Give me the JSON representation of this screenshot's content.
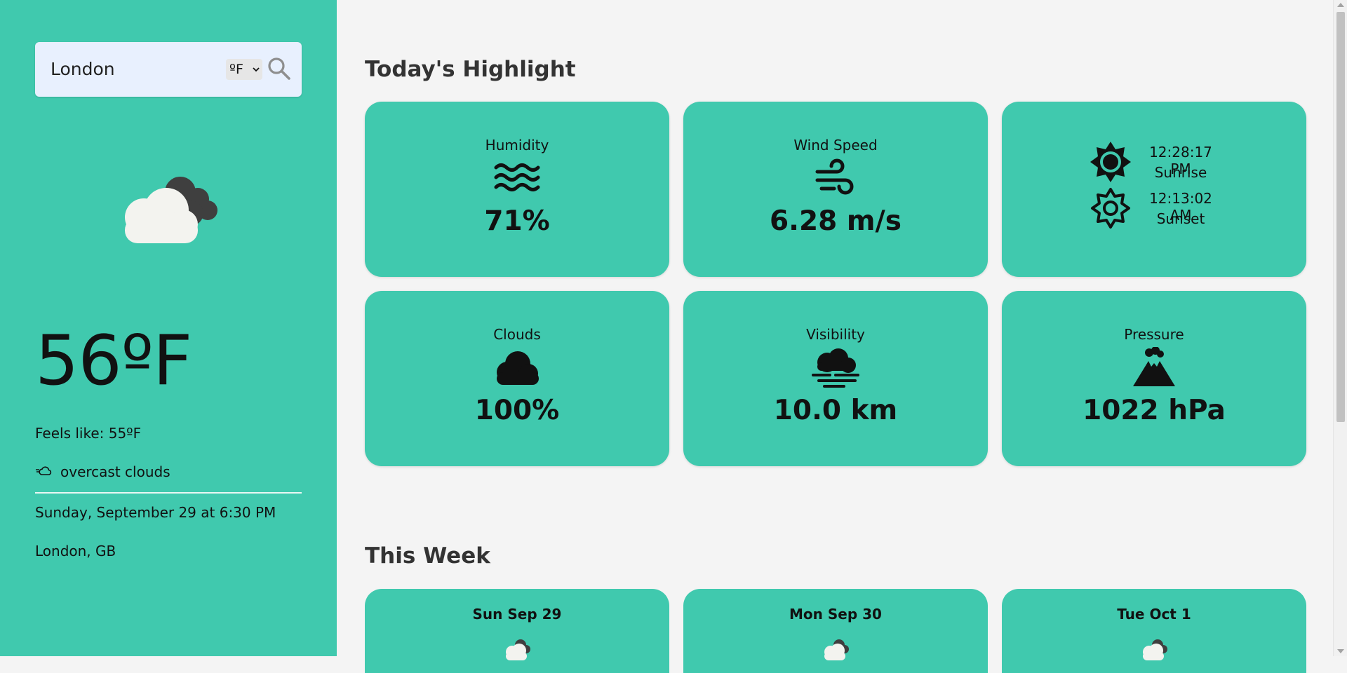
{
  "search": {
    "value": "London",
    "unit": "ºF"
  },
  "current": {
    "temp": "56ºF",
    "feels_like": "Feels like: 55ºF",
    "condition": "overcast clouds",
    "date": "Sunday, September 29 at 6:30 PM",
    "location": "London, GB"
  },
  "highlights": {
    "title": "Today's Highlight",
    "humidity": {
      "label": "Humidity",
      "value": "71%"
    },
    "wind": {
      "label": "Wind Speed",
      "value": "6.28 m/s"
    },
    "sunrise": {
      "time": "12:28:17 PM",
      "label": "Sunrise"
    },
    "sunset": {
      "time": "12:13:02 AM",
      "label": "Sunset"
    },
    "clouds": {
      "label": "Clouds",
      "value": "100%"
    },
    "visibility": {
      "label": "Visibility",
      "value": "10.0 km"
    },
    "pressure": {
      "label": "Pressure",
      "value": "1022 hPa"
    }
  },
  "week": {
    "title": "This Week",
    "days": [
      {
        "label": "Sun Sep 29",
        "icon": "cloud-icon"
      },
      {
        "label": "Mon Sep 30",
        "icon": "cloud-icon"
      },
      {
        "label": "Tue Oct 1",
        "icon": "cloud-icon"
      }
    ]
  },
  "colors": {
    "sidebar": "#40c9ae",
    "card": "#40c9ae",
    "background": "#f4f4f4",
    "search_bg": "#e8f0fe"
  }
}
